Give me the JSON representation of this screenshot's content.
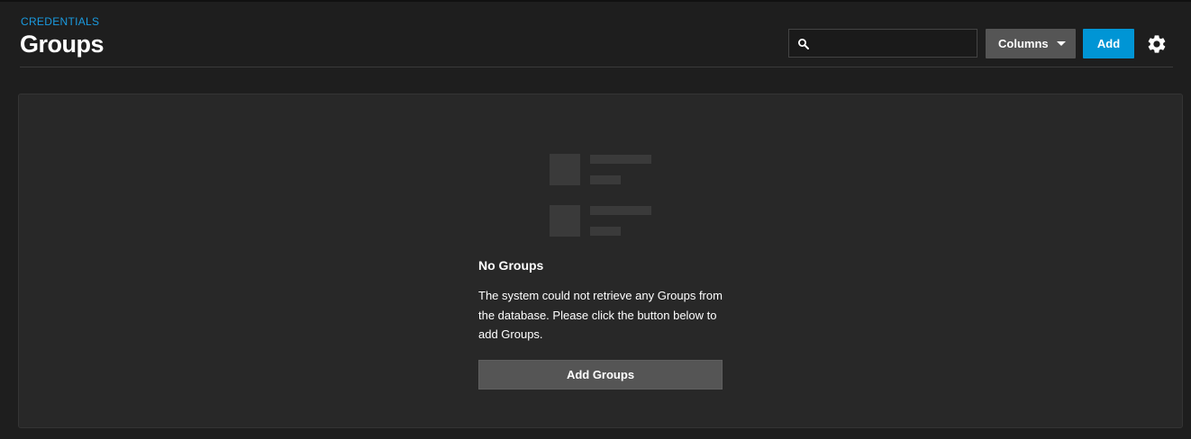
{
  "header": {
    "breadcrumb": "CREDENTIALS",
    "title": "Groups"
  },
  "toolbar": {
    "search_placeholder": "",
    "search_value": "",
    "columns_label": "Columns",
    "add_label": "Add",
    "search_icon": "search-icon",
    "columns_icon": "chevron-down-icon",
    "settings_icon": "gear-icon"
  },
  "empty_state": {
    "title": "No Groups",
    "message": "The system could not retrieve any Groups from the database. Please click the button below to add Groups.",
    "button_label": "Add Groups",
    "icon": "list-placeholder-icon"
  },
  "colors": {
    "accent": "#0095d5",
    "breadcrumb": "#1a9be0",
    "background": "#1e1e1e",
    "card": "#282828",
    "secondary_button": "#555555"
  }
}
